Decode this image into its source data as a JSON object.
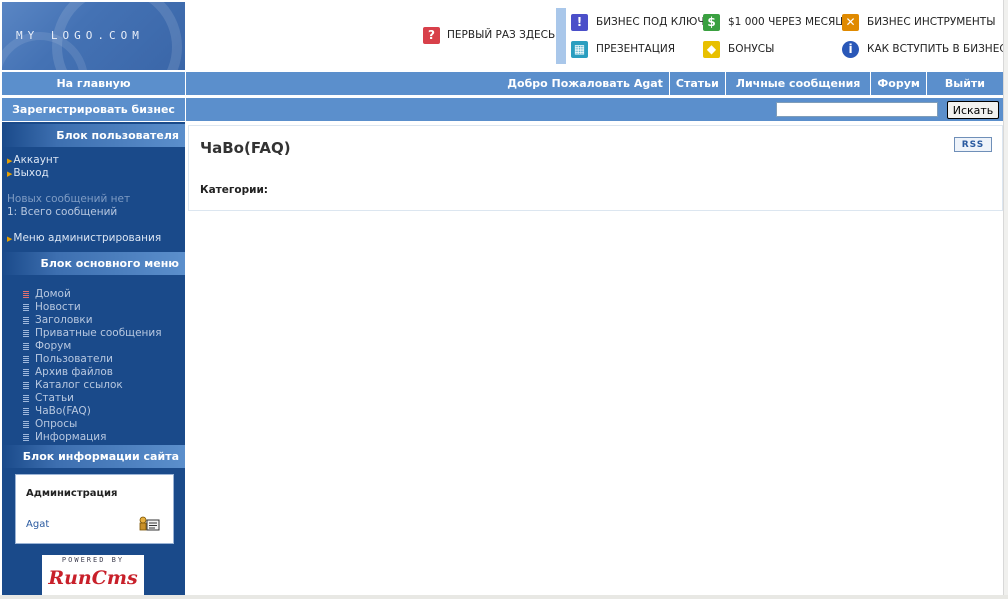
{
  "logo": {
    "text": "MY LOGO.COM"
  },
  "header": {
    "first_time": "ПЕРВЫЙ РАЗ ЗДЕСЬ?",
    "links": [
      {
        "label": "БИЗНЕС ПОД КЛЮЧ",
        "icon": "exclamation-icon",
        "color": "#4b4fc9"
      },
      {
        "label": "$1 000 ЧЕРЕЗ МЕСЯЦ",
        "icon": "dollar-icon",
        "color": "#3aa040"
      },
      {
        "label": "БИЗНЕС ИНСТРУМЕНТЫ",
        "icon": "tools-icon",
        "color": "#e08a00"
      },
      {
        "label": "ПРЕЗЕНТАЦИЯ",
        "icon": "film-icon",
        "color": "#2a9ec0"
      },
      {
        "label": "БОНУСЫ",
        "icon": "bonus-icon",
        "color": "#e8c000"
      },
      {
        "label": "КАК ВСТУПИТЬ В БИЗНЕС",
        "icon": "info-icon",
        "color": "#2a58b8"
      }
    ]
  },
  "nav": {
    "home": "На главную",
    "register": "Зарегистрировать бизнес",
    "items": [
      "Добро Пожаловать Agat",
      "Статьи",
      "Личные сообщения",
      "Форум",
      "Выйти"
    ]
  },
  "search": {
    "value": "",
    "button_label": "Искать"
  },
  "sidebar": {
    "user_block": {
      "title": "Блок пользователя",
      "links": [
        "Аккаунт",
        "Выход"
      ],
      "no_messages": "Новых сообщений нет",
      "total_messages": "1: Всего сообщений",
      "admin_menu": "Меню администрирования"
    },
    "main_menu": {
      "title": "Блок основного меню",
      "items": [
        "Домой",
        "Новости",
        "Заголовки",
        "Приватные сообщения",
        "Форум",
        "Пользователи",
        "Архив файлов",
        "Каталог ссылок",
        "Статьи",
        "ЧаВо(FAQ)",
        "Опросы",
        "Информация"
      ]
    },
    "site_info": {
      "title": "Блок информации сайта",
      "admin_title": "Администрация",
      "admin_user": "Agat"
    },
    "powered": {
      "line1": "POWERED BY",
      "line2": "RunCms"
    }
  },
  "content": {
    "title": "ЧаВо(FAQ)",
    "rss": "RSS",
    "categories": "Категории:"
  }
}
